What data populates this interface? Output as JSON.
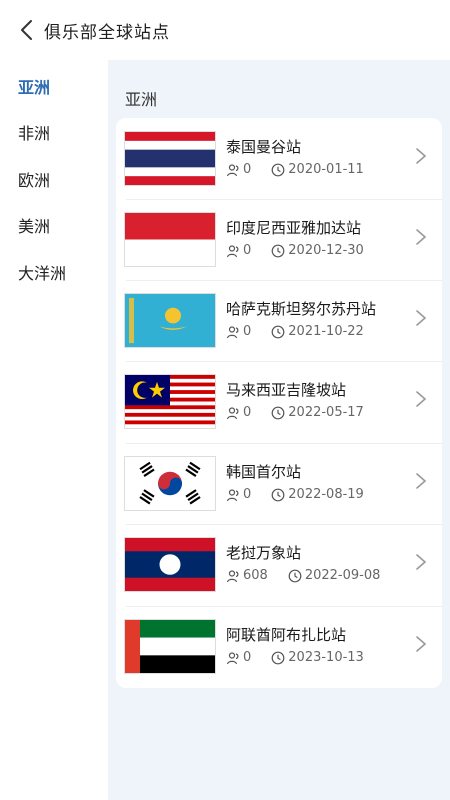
{
  "header": {
    "title": "俱乐部全球站点",
    "back_icon": "chevron-left-icon"
  },
  "sidebar": {
    "items": [
      {
        "label": "亚洲",
        "active": true
      },
      {
        "label": "非洲",
        "active": false
      },
      {
        "label": "欧洲",
        "active": false
      },
      {
        "label": "美洲",
        "active": false
      },
      {
        "label": "大洋洲",
        "active": false
      }
    ]
  },
  "main": {
    "section_title": "亚洲",
    "stations": [
      {
        "name": "泰国曼谷站",
        "members": "0",
        "date": "2020-01-11",
        "flag": "thailand-flag"
      },
      {
        "name": "印度尼西亚雅加达站",
        "members": "0",
        "date": "2020-12-30",
        "flag": "indonesia-flag"
      },
      {
        "name": "哈萨克斯坦努尔苏丹站",
        "members": "0",
        "date": "2021-10-22",
        "flag": "kazakhstan-flag"
      },
      {
        "name": "马来西亚吉隆坡站",
        "members": "0",
        "date": "2022-05-17",
        "flag": "malaysia-flag"
      },
      {
        "name": "韩国首尔站",
        "members": "0",
        "date": "2022-08-19",
        "flag": "south-korea-flag"
      },
      {
        "name": "老挝万象站",
        "members": "608",
        "date": "2022-09-08",
        "flag": "laos-flag"
      },
      {
        "name": "阿联酋阿布扎比站",
        "members": "0",
        "date": "2023-10-13",
        "flag": "uae-flag"
      }
    ]
  },
  "colors": {
    "accent": "#2f6db3",
    "page_bg": "#eff3fa"
  }
}
